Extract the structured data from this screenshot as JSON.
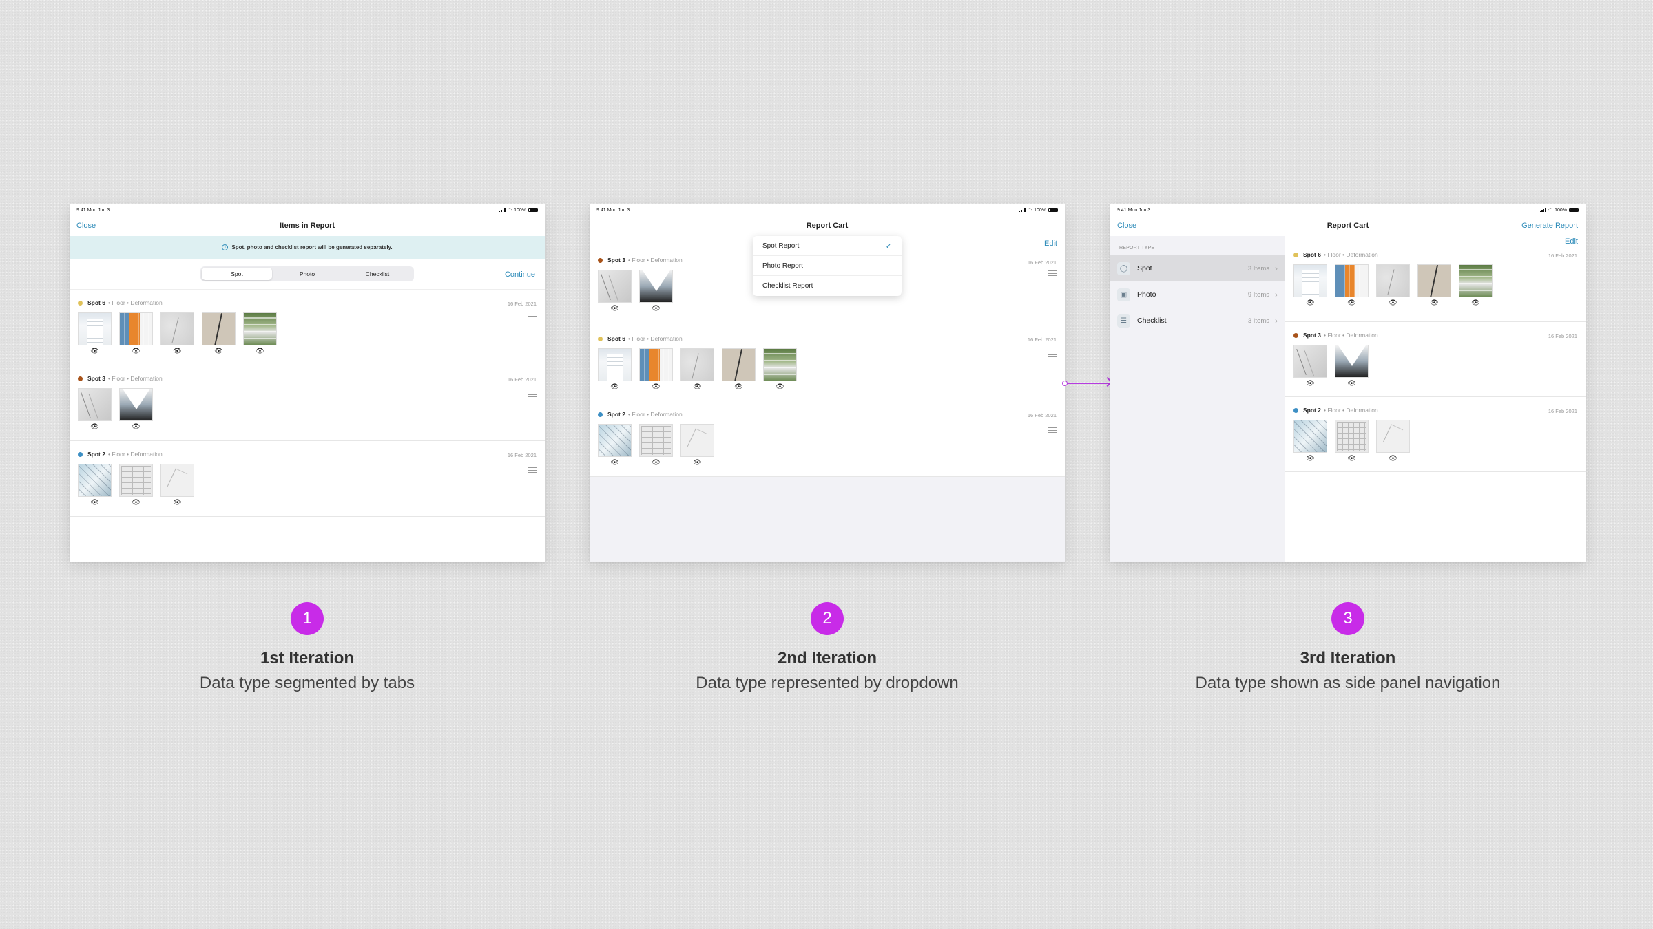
{
  "status": {
    "time": "9:41 Mon Jun 3",
    "battery": "100%"
  },
  "screen1": {
    "close": "Close",
    "title": "Items in Report",
    "banner": "Spot, photo and checklist report will be generated separately.",
    "tabs": [
      "Spot",
      "Photo",
      "Checklist"
    ],
    "continue": "Continue",
    "spots": [
      {
        "name": "Spot 6",
        "sub": "• Floor • Deformation",
        "date": "16 Feb 2021",
        "color": "#e0c25a"
      },
      {
        "name": "Spot 3",
        "sub": "• Floor • Deformation",
        "date": "16 Feb 2021",
        "color": "#a8531a"
      },
      {
        "name": "Spot 2",
        "sub": "• Floor • Deformation",
        "date": "16 Feb 2021",
        "color": "#3d8fc4"
      }
    ]
  },
  "screen2": {
    "title": "Report Cart",
    "edit": "Edit",
    "dropdown": [
      "Spot Report",
      "Photo Report",
      "Checklist Report"
    ],
    "spots": [
      {
        "name": "Spot 3",
        "sub": "• Floor • Deformation",
        "date": "16 Feb 2021",
        "color": "#a8531a"
      },
      {
        "name": "Spot 6",
        "sub": "• Floor • Deformation",
        "date": "16 Feb 2021",
        "color": "#e0c25a"
      },
      {
        "name": "Spot 2",
        "sub": "• Floor • Deformation",
        "date": "16 Feb 2021",
        "color": "#3d8fc4"
      }
    ]
  },
  "screen3": {
    "close": "Close",
    "title": "Report Cart",
    "generate": "Generate Report",
    "edit": "Edit",
    "report_type_label": "REPORT TYPE",
    "side_items": [
      {
        "label": "Spot",
        "count": "3 Items",
        "icon": "spot-icon"
      },
      {
        "label": "Photo",
        "count": "9 Items",
        "icon": "photo-icon"
      },
      {
        "label": "Checklist",
        "count": "3 Items",
        "icon": "checklist-icon"
      }
    ],
    "spots": [
      {
        "name": "Spot 6",
        "sub": "• Floor • Deformation",
        "date": "16 Feb 2021",
        "color": "#e0c25a"
      },
      {
        "name": "Spot 3",
        "sub": "• Floor • Deformation",
        "date": "16 Feb 2021",
        "color": "#a8531a"
      },
      {
        "name": "Spot 2",
        "sub": "• Floor • Deformation",
        "date": "16 Feb 2021",
        "color": "#3d8fc4"
      }
    ]
  },
  "captions": [
    {
      "num": "1",
      "title": "1st Iteration",
      "desc": "Data type segmented by tabs"
    },
    {
      "num": "2",
      "title": "2nd Iteration",
      "desc": "Data type represented by dropdown"
    },
    {
      "num": "3",
      "title": "3rd Iteration",
      "desc": "Data type shown as side panel navigation"
    }
  ],
  "colors": {
    "accent": "#2b8ab8",
    "badge": "#c82be8",
    "banner": "#def0f2"
  }
}
